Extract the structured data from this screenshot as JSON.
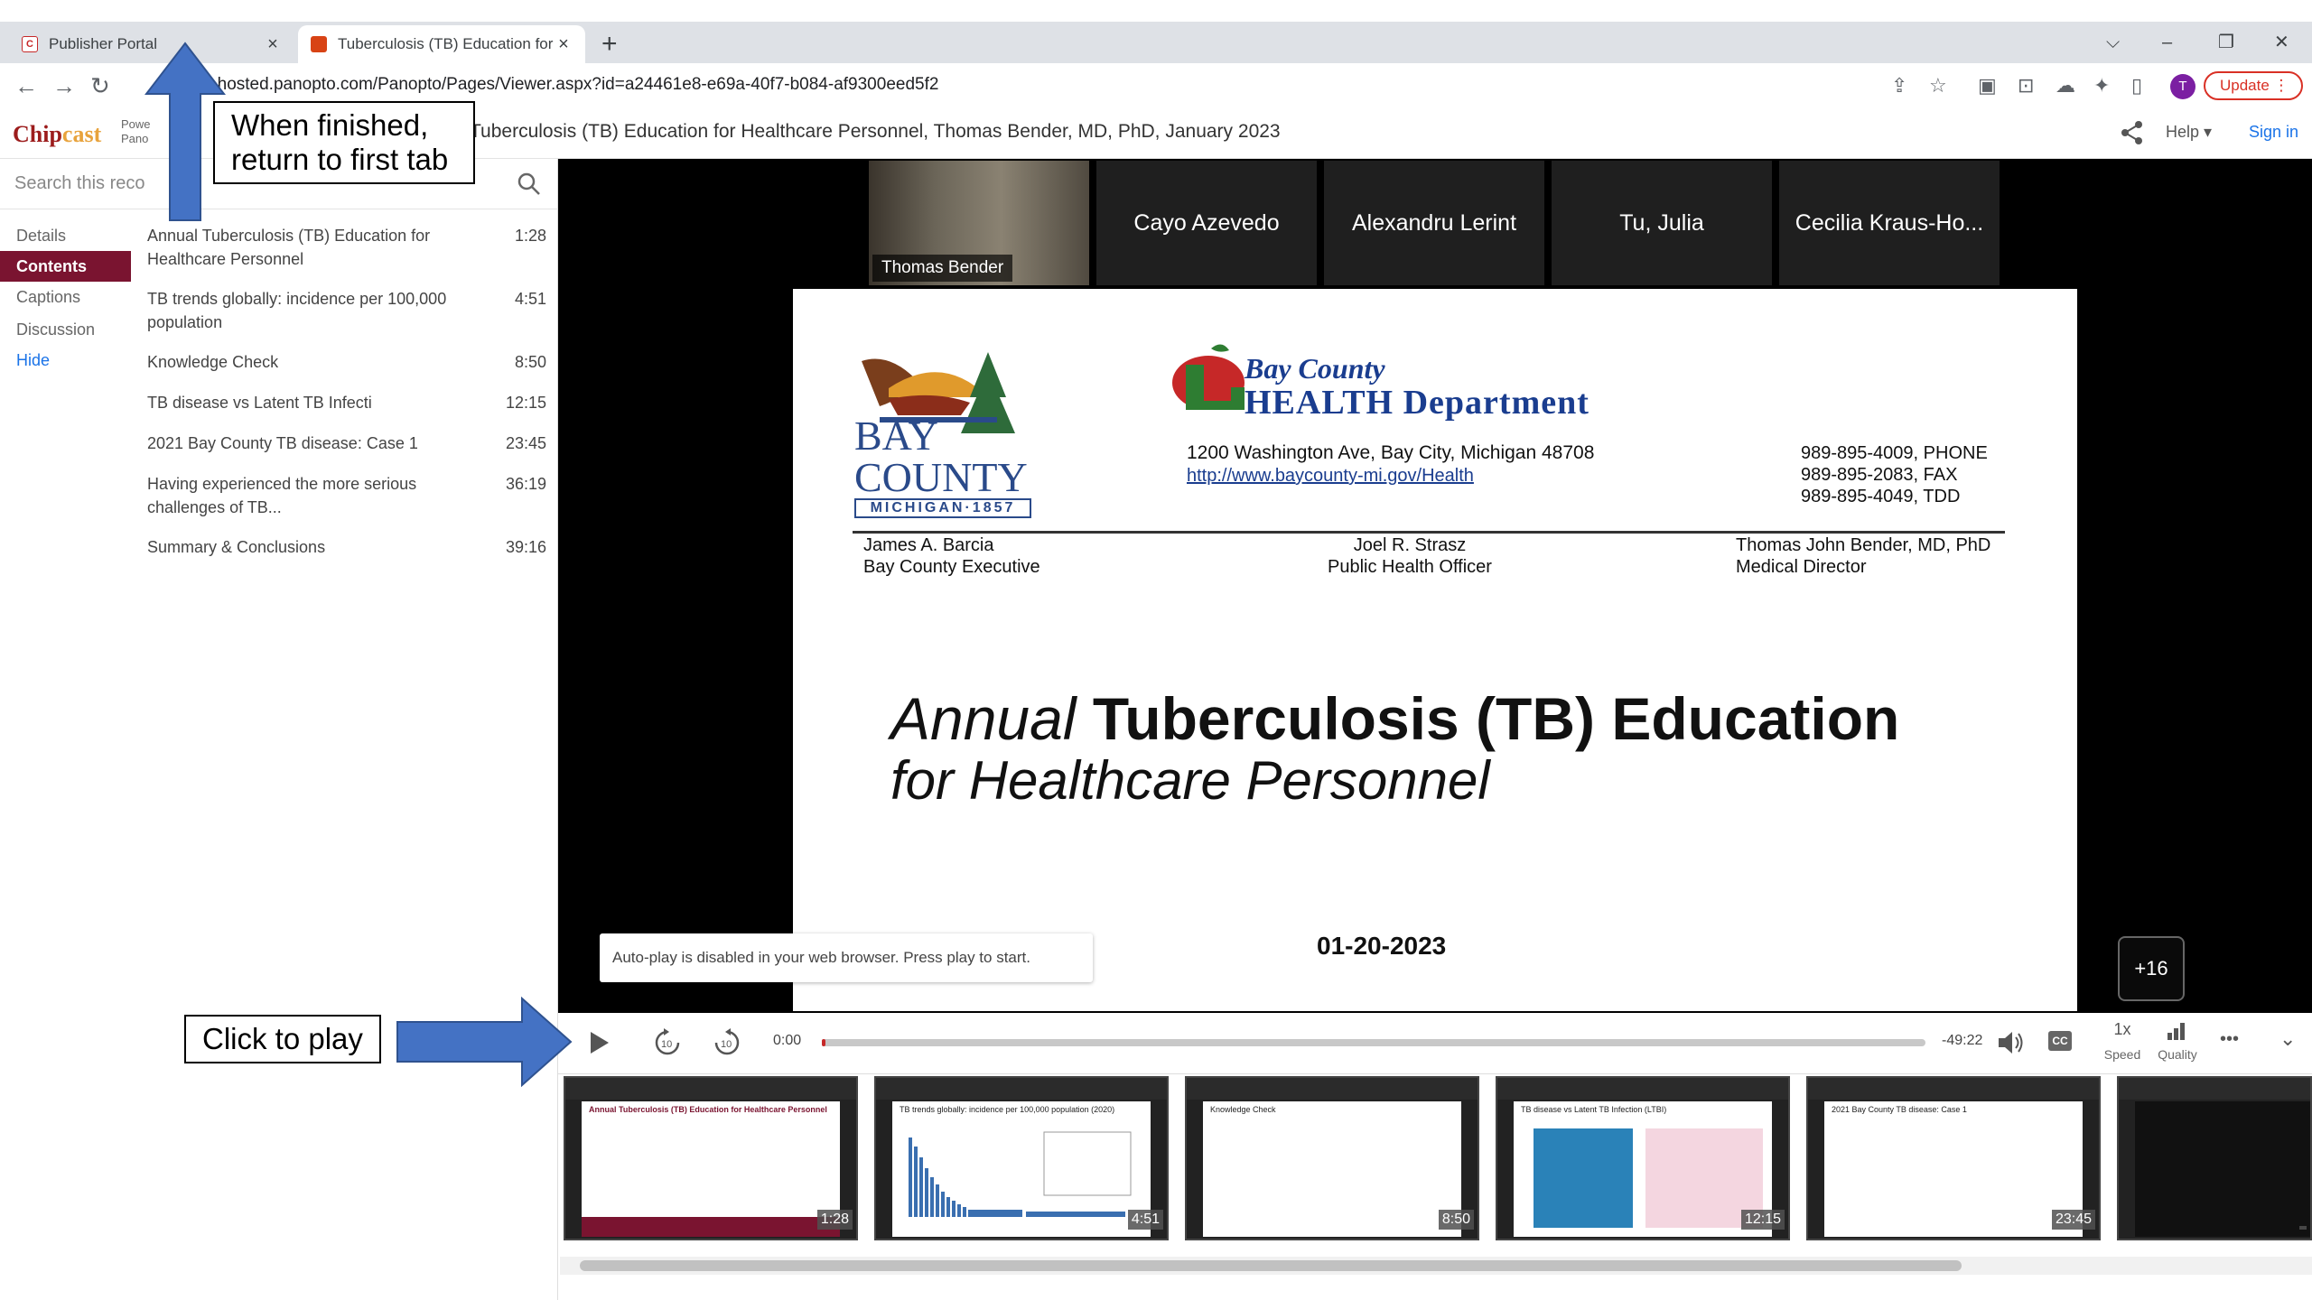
{
  "browser": {
    "tabs": [
      {
        "title": "Publisher Portal",
        "close": "×",
        "active": false
      },
      {
        "title": "Tuberculosis (TB) Education for H",
        "close": "×",
        "active": true
      }
    ],
    "new_tab": "+",
    "window_controls": [
      "⌵",
      "–",
      "❐",
      "✕"
    ],
    "url": "est.hosted.panopto.com/Panopto/Pages/Viewer.aspx?id=a24461e8-e69a-40f7-b084-af9300eed5f2",
    "avatar_letter": "T",
    "update_label": "Update",
    "colors": {
      "update": "#d93025",
      "avatar": "#7b1fa2"
    }
  },
  "header": {
    "logo": "Chip",
    "logo_accent": "cast",
    "powered": "Powe Pano",
    "title": "Tuberculosis (TB) Education for Healthcare Personnel, Thomas Bender, MD, PhD, January 2023",
    "help": "Help ▾",
    "signin": "Sign in"
  },
  "sidebar": {
    "search_placeholder": "Search this reco",
    "nav": [
      {
        "label": "Details",
        "active": false
      },
      {
        "label": "Contents",
        "active": true
      },
      {
        "label": "Captions",
        "active": false
      },
      {
        "label": "Discussion",
        "active": false
      },
      {
        "label": "Hide",
        "active": false
      }
    ],
    "entries": [
      {
        "title": "Annual Tuberculosis (TB) Education for Healthcare Personnel",
        "time": "1:28"
      },
      {
        "title": "TB trends globally: incidence per 100,000 population",
        "time": "4:51"
      },
      {
        "title": "Knowledge Check",
        "time": "8:50"
      },
      {
        "title": "TB disease vs Latent TB Infecti",
        "time": "12:15"
      },
      {
        "title": "2021 Bay County TB disease: Case 1",
        "time": "23:45"
      },
      {
        "title": "Having experienced the more serious challenges of TB...",
        "time": "36:19"
      },
      {
        "title": "Summary & Conclusions",
        "time": "39:16"
      }
    ],
    "accent_color": "#7a1430"
  },
  "participants": {
    "camera_name": "Thomas Bender",
    "tiles": [
      "Cayo Azevedo",
      "Alexandru Lerint",
      "Tu, Julia",
      "Cecilia Kraus-Ho..."
    ],
    "more_count": "+16"
  },
  "slide": {
    "bay_county": {
      "line1": "BAY",
      "line2": "COUNTY",
      "state": "MICHIGAN·1857"
    },
    "health_dept": {
      "line1": "Bay County",
      "line2": "HEALTH Department"
    },
    "address": "1200 Washington Ave, Bay City, Michigan 48708",
    "website": "http://www.baycounty-mi.gov/Health",
    "phones": [
      "989-895-4009, PHONE",
      "989-895-2083, FAX",
      "989-895-4049, TDD"
    ],
    "officials": [
      {
        "name": "James A. Barcia",
        "role": "Bay County Executive"
      },
      {
        "name": "Joel R. Strasz",
        "role": "Public Health Officer"
      },
      {
        "name": "Thomas John Bender, MD, PhD",
        "role": "Medical Director"
      }
    ],
    "title_italic": "Annual",
    "title_bold": "Tuberculosis (TB) Education",
    "subtitle": "for Healthcare Personnel",
    "date": "01-20-2023"
  },
  "player": {
    "autoplay_notice": "Auto-play is disabled in your web browser. Press play to start.",
    "current_time": "0:00",
    "remaining_time": "-49:22",
    "progress": 0.0,
    "speed_value": "1x",
    "speed_label": "Speed",
    "quality_label": "Quality",
    "cc": "CC",
    "more": "•••"
  },
  "thumbnails": [
    {
      "time": "1:28",
      "title": "Annual Tuberculosis (TB) Education for Healthcare Personnel"
    },
    {
      "time": "4:51",
      "title": "TB trends globally: incidence per 100,000 population (2020)"
    },
    {
      "time": "8:50",
      "title": "Knowledge Check"
    },
    {
      "time": "12:15",
      "title": "TB disease vs Latent TB Infection (LTBI)"
    },
    {
      "time": "23:45",
      "title": "2021 Bay County TB disease: Case 1"
    },
    {
      "time": "",
      "title": ""
    }
  ],
  "annotations": {
    "top_callout": "When finished, return to first tab",
    "play_callout": "Click to play",
    "arrow_color": "#4472c4"
  }
}
